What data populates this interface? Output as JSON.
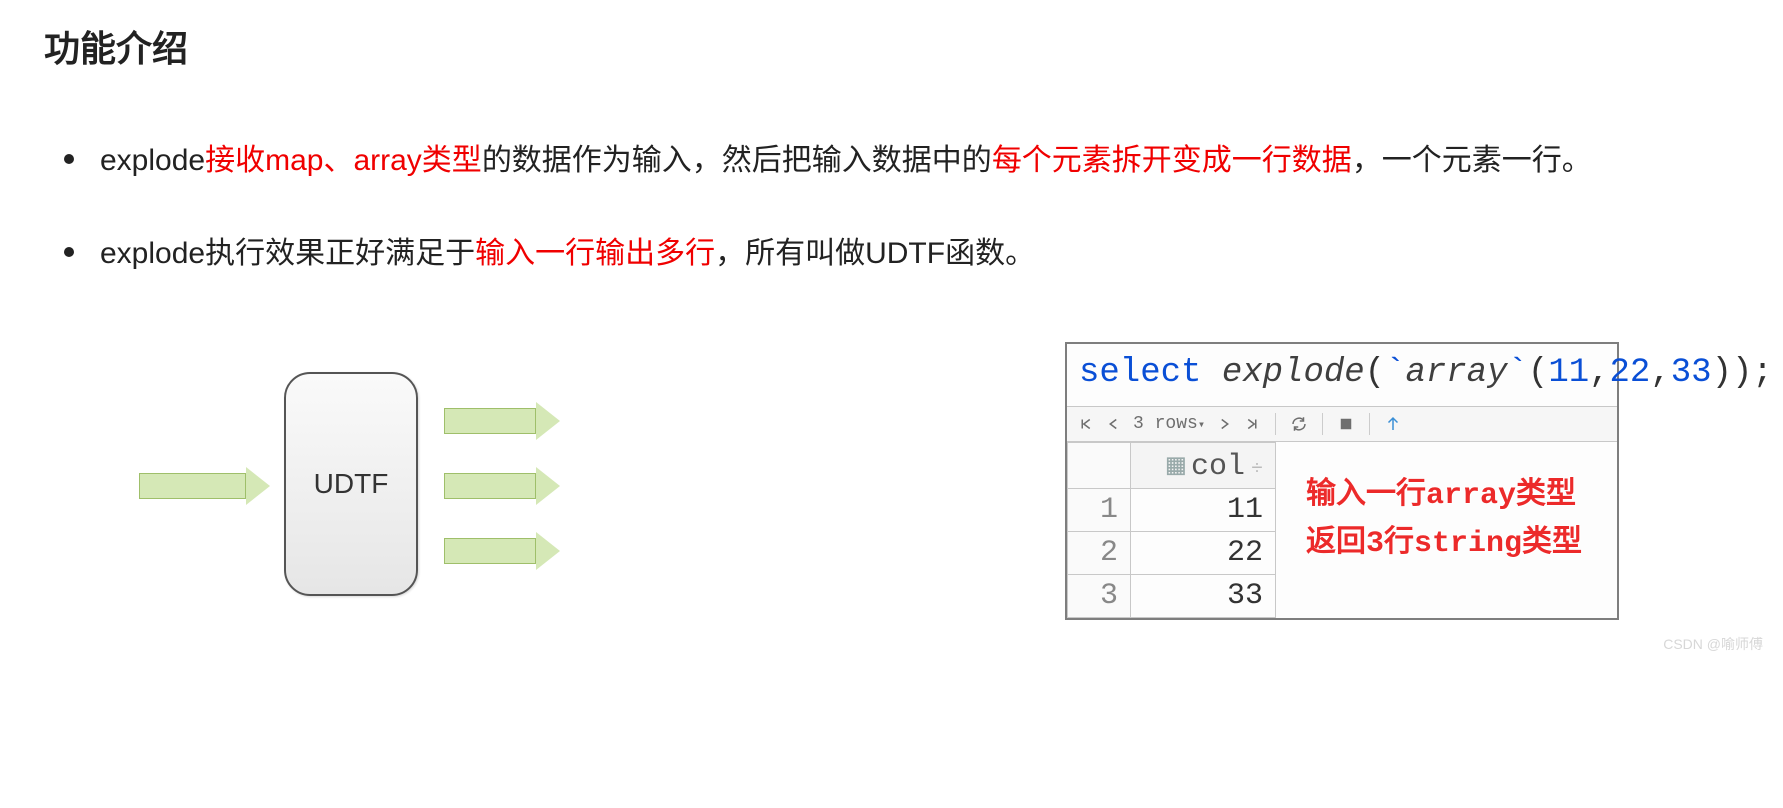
{
  "title": "功能介绍",
  "bullets": {
    "b1": {
      "p1": "explode",
      "p2_red": "接收map、array类型",
      "p3": "的数据作为输入，然后把输入数据中的",
      "p4_red": "每个元素拆开变成一行数据",
      "p5": "，一个元素一行。"
    },
    "b2": {
      "p1": "explode执行效果正好满足于",
      "p2_red": "输入一行输出多行",
      "p3": "，所有叫做UDTF函数。"
    }
  },
  "diagram": {
    "box_label": "UDTF"
  },
  "sql": {
    "select": "select",
    "space": " ",
    "func": "explode",
    "open": "(",
    "back1": "`",
    "arr": "array",
    "back2": "`",
    "open2": "(",
    "n1": "11",
    "c1": ",",
    "n2": "22",
    "c2": ",",
    "n3": "33",
    "close": "));"
  },
  "toolbar": {
    "rows_label": "3 rows"
  },
  "grid": {
    "col_header": "col",
    "rows": [
      {
        "idx": "1",
        "val": "11"
      },
      {
        "idx": "2",
        "val": "22"
      },
      {
        "idx": "3",
        "val": "33"
      }
    ]
  },
  "annot": {
    "line1": "输入一行array类型",
    "line2": "返回3行string类型"
  },
  "watermark": "CSDN @喻师傅"
}
